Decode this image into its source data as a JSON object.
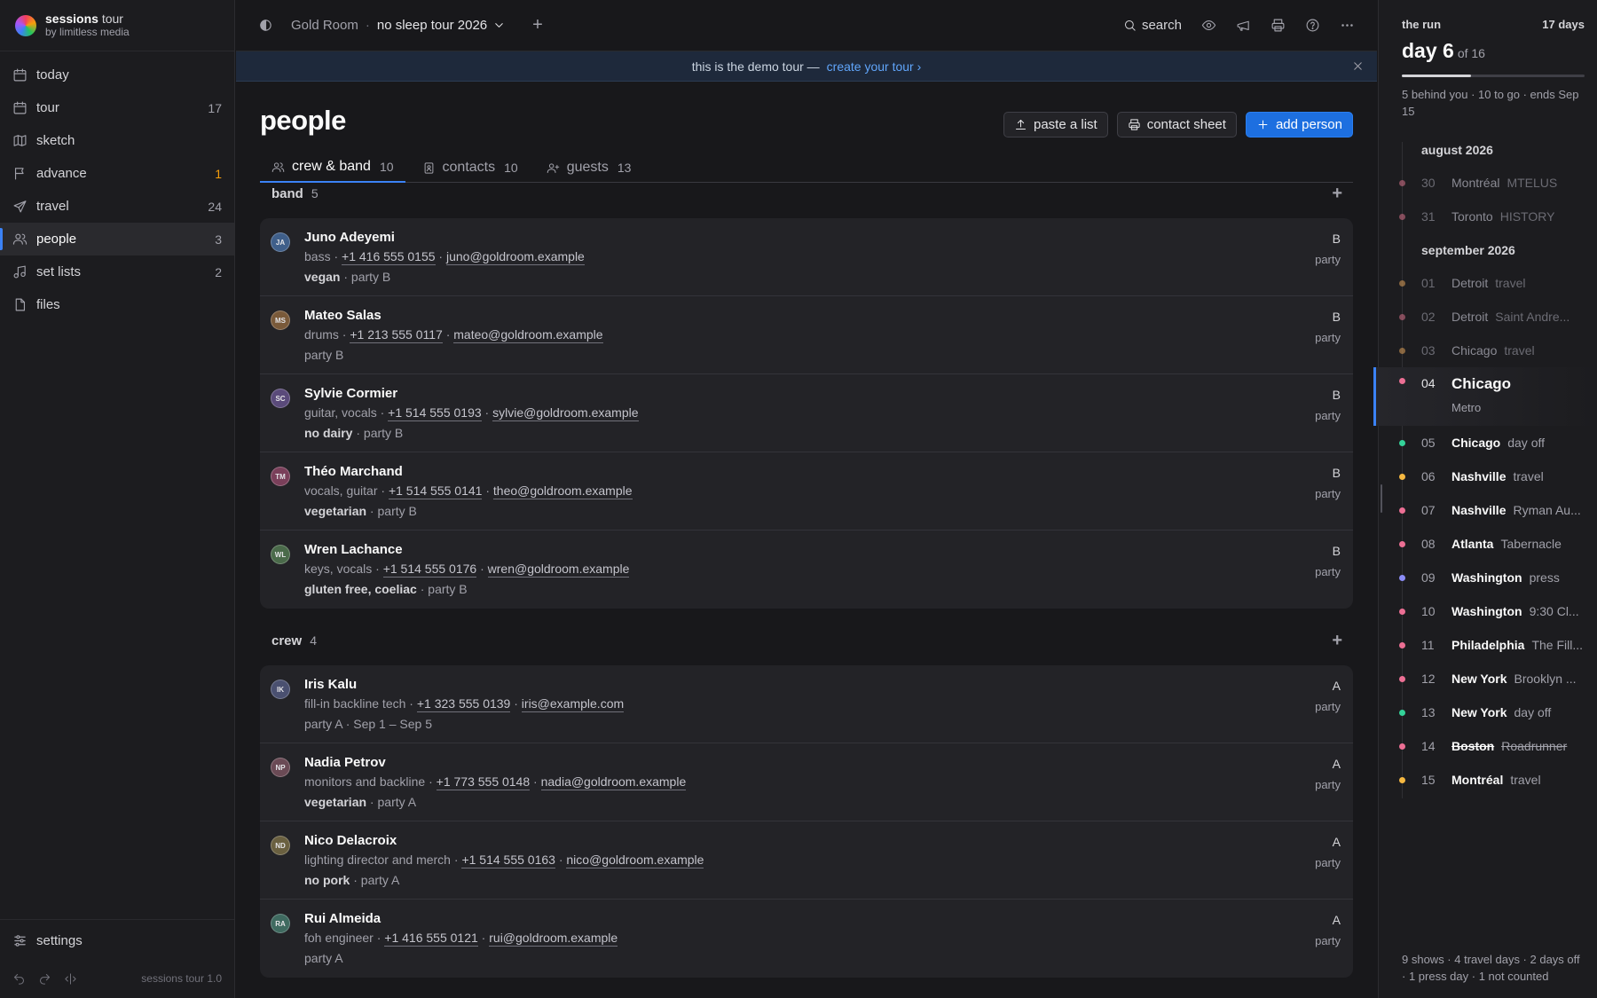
{
  "app": {
    "name": "sessions",
    "name_suffix": "tour",
    "by": "by limitless media",
    "version": "sessions tour 1.0"
  },
  "sidebar": {
    "items": [
      {
        "label": "today",
        "count": ""
      },
      {
        "label": "tour",
        "count": "17"
      },
      {
        "label": "sketch",
        "count": ""
      },
      {
        "label": "advance",
        "count": "1"
      },
      {
        "label": "travel",
        "count": "24"
      },
      {
        "label": "people",
        "count": "3"
      },
      {
        "label": "set lists",
        "count": "2"
      },
      {
        "label": "files",
        "count": ""
      }
    ],
    "settings_label": "settings"
  },
  "topbar": {
    "room": "Gold Room",
    "tour": "no sleep tour 2026",
    "search_label": "search"
  },
  "banner": {
    "text": "this is the demo tour —",
    "link": "create your tour ›"
  },
  "page": {
    "title": "people",
    "actions": {
      "paste": "paste a list",
      "contact": "contact sheet",
      "add": "add person"
    },
    "tabs": [
      {
        "label": "crew & band",
        "count": "10"
      },
      {
        "label": "contacts",
        "count": "10"
      },
      {
        "label": "guests",
        "count": "13"
      }
    ],
    "groups": [
      {
        "name": "band",
        "count": "5",
        "people": [
          {
            "initials": "JA",
            "name": "Juno Adeyemi",
            "role": "bass",
            "phone": "+1 416 555 0155",
            "email": "juno@goldroom.example",
            "diet": "vegan",
            "party_text": "party B",
            "party": "B",
            "party_label": "party"
          },
          {
            "initials": "MS",
            "name": "Mateo Salas",
            "role": "drums",
            "phone": "+1 213 555 0117",
            "email": "mateo@goldroom.example",
            "diet": "",
            "party_text": "party B",
            "party": "B",
            "party_label": "party"
          },
          {
            "initials": "SC",
            "name": "Sylvie Cormier",
            "role": "guitar, vocals",
            "phone": "+1 514 555 0193",
            "email": "sylvie@goldroom.example",
            "diet": "no dairy",
            "party_text": "party B",
            "party": "B",
            "party_label": "party"
          },
          {
            "initials": "TM",
            "name": "Théo Marchand",
            "role": "vocals, guitar",
            "phone": "+1 514 555 0141",
            "email": "theo@goldroom.example",
            "diet": "vegetarian",
            "party_text": "party B",
            "party": "B",
            "party_label": "party"
          },
          {
            "initials": "WL",
            "name": "Wren Lachance",
            "role": "keys, vocals",
            "phone": "+1 514 555 0176",
            "email": "wren@goldroom.example",
            "diet": "gluten free, coeliac",
            "party_text": "party B",
            "party": "B",
            "party_label": "party"
          }
        ]
      },
      {
        "name": "crew",
        "count": "4",
        "people": [
          {
            "initials": "IK",
            "name": "Iris Kalu",
            "role": "fill-in backline tech",
            "phone": "+1 323 555 0139",
            "email": "iris@example.com",
            "diet": "",
            "party_text": "party A · Sep 1 – Sep 5",
            "party": "A",
            "party_label": "party"
          },
          {
            "initials": "NP",
            "name": "Nadia Petrov",
            "role": "monitors and backline",
            "phone": "+1 773 555 0148",
            "email": "nadia@goldroom.example",
            "diet": "vegetarian",
            "party_text": "party A",
            "party": "A",
            "party_label": "party"
          },
          {
            "initials": "ND",
            "name": "Nico Delacroix",
            "role": "lighting director and merch",
            "phone": "+1 514 555 0163",
            "email": "nico@goldroom.example",
            "diet": "no pork",
            "party_text": "party A",
            "party": "A",
            "party_label": "party"
          },
          {
            "initials": "RA",
            "name": "Rui Almeida",
            "role": "foh engineer",
            "phone": "+1 416 555 0121",
            "email": "rui@goldroom.example",
            "diet": "",
            "party_text": "party A",
            "party": "A",
            "party_label": "party"
          }
        ]
      }
    ]
  },
  "run": {
    "title": "the run",
    "days": "17 days",
    "day_label": "day 6",
    "of_label": "of 16",
    "progress": 0.38,
    "summary": "5 behind you · 10 to go · ends Sep 15",
    "months": [
      {
        "label": "august 2026",
        "dates": [
          {
            "day": "30",
            "city": "Montréal",
            "venue": "MTELUS",
            "color": "#d9738a",
            "past": true
          },
          {
            "day": "31",
            "city": "Toronto",
            "venue": "HISTORY",
            "color": "#d9738a",
            "past": true
          }
        ]
      },
      {
        "label": "september 2026",
        "dates": [
          {
            "day": "01",
            "city": "Detroit",
            "venue": "travel",
            "color": "#e0a35a",
            "past": true
          },
          {
            "day": "02",
            "city": "Detroit",
            "venue": "Saint Andre...",
            "color": "#d9738a",
            "past": true
          },
          {
            "day": "03",
            "city": "Chicago",
            "venue": "travel",
            "color": "#e0a35a",
            "past": true
          },
          {
            "day": "04",
            "city": "Chicago",
            "venue": "Metro",
            "color": "#ec6f94",
            "current": true
          },
          {
            "day": "05",
            "city": "Chicago",
            "venue": "day off",
            "color": "#34d399"
          },
          {
            "day": "06",
            "city": "Nashville",
            "venue": "travel",
            "color": "#f5b841"
          },
          {
            "day": "07",
            "city": "Nashville",
            "venue": "Ryman Au...",
            "color": "#ec6f94"
          },
          {
            "day": "08",
            "city": "Atlanta",
            "venue": "Tabernacle",
            "color": "#ec6f94"
          },
          {
            "day": "09",
            "city": "Washington",
            "venue": "press",
            "color": "#8b8cf6"
          },
          {
            "day": "10",
            "city": "Washington",
            "venue": "9:30 Cl...",
            "color": "#ec6f94"
          },
          {
            "day": "11",
            "city": "Philadelphia",
            "venue": "The Fill...",
            "color": "#ec6f94"
          },
          {
            "day": "12",
            "city": "New York",
            "venue": "Brooklyn ...",
            "color": "#ec6f94"
          },
          {
            "day": "13",
            "city": "New York",
            "venue": "day off",
            "color": "#34d399"
          },
          {
            "day": "14",
            "city": "Boston",
            "venue": "Roadrunner",
            "color": "#ec6f94",
            "strike": true
          },
          {
            "day": "15",
            "city": "Montréal",
            "venue": "travel",
            "color": "#f5b841"
          }
        ]
      }
    ],
    "footer": "9 shows · 4 travel days · 2 days off · 1 press day · 1 not counted"
  }
}
